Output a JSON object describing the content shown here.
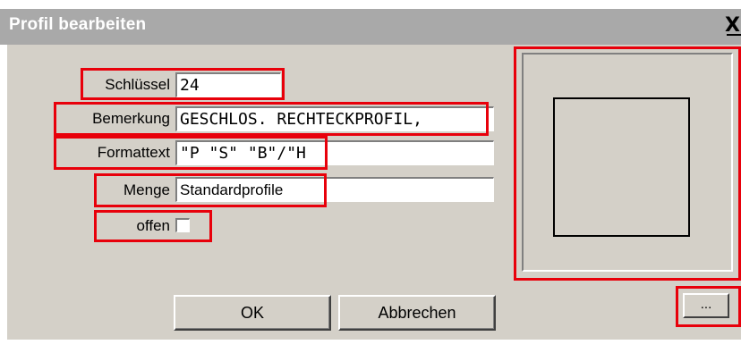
{
  "window": {
    "title": "Profil bearbeiten",
    "close_label": "X"
  },
  "form": {
    "schluessel": {
      "label": "Schlüssel",
      "value": "24"
    },
    "bemerkung": {
      "label": "Bemerkung",
      "value": "GESCHLOS. RECHTECKPROFIL,"
    },
    "formattext": {
      "label": "Formattext",
      "value": "\"P \"S\"  \"B\"/\"H"
    },
    "menge": {
      "label": "Menge",
      "value": "Standardprofile"
    },
    "offen": {
      "label": "offen",
      "checked": false
    }
  },
  "buttons": {
    "ok": "OK",
    "cancel": "Abbrechen",
    "browse": "..."
  },
  "colors": {
    "highlight": "#e8000b",
    "dialog_bg": "#d4d0c8",
    "titlebar_bg": "#a9a9a9"
  }
}
